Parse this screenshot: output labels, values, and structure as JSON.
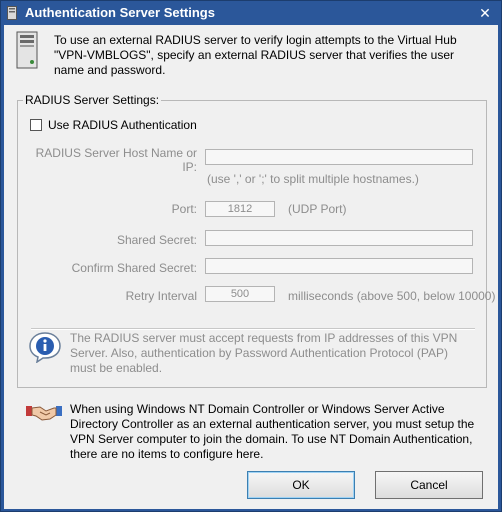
{
  "window": {
    "title": "Authentication Server Settings",
    "close_glyph": "✕"
  },
  "intro": {
    "text": "To use an external RADIUS server to verify login attempts to the Virtual Hub \"VPN-VMBLOGS\", specify an external RADIUS server that verifies the user name and password."
  },
  "radius_group": {
    "label": "RADIUS Server Settings:",
    "use_radius_label": "Use RADIUS Authentication",
    "use_radius_checked": false,
    "host_label": "RADIUS Server Host Name or IP:",
    "host_value": "",
    "host_hint": "(use ',' or ';' to split multiple hostnames.)",
    "port_label": "Port:",
    "port_value": "1812",
    "port_hint": "(UDP Port)",
    "secret_label": "Shared Secret:",
    "secret_value": "",
    "confirm_label": "Confirm Shared Secret:",
    "confirm_value": "",
    "retry_label": "Retry Interval",
    "retry_value": "500",
    "retry_hint": "milliseconds (above 500, below 10000)",
    "info_text": "The RADIUS server must accept requests from IP addresses of this VPN Server. Also, authentication by Password Authentication Protocol (PAP) must be enabled."
  },
  "nt_domain": {
    "text": "When using Windows NT Domain Controller or Windows Server Active Directory Controller as an external authentication server, you must setup the VPN Server computer to join the domain. To use NT Domain Authentication, there are no items to configure here."
  },
  "buttons": {
    "ok": "OK",
    "cancel": "Cancel"
  },
  "colors": {
    "titlebar": "#2b579a",
    "disabled_text": "#8d8d8d"
  }
}
